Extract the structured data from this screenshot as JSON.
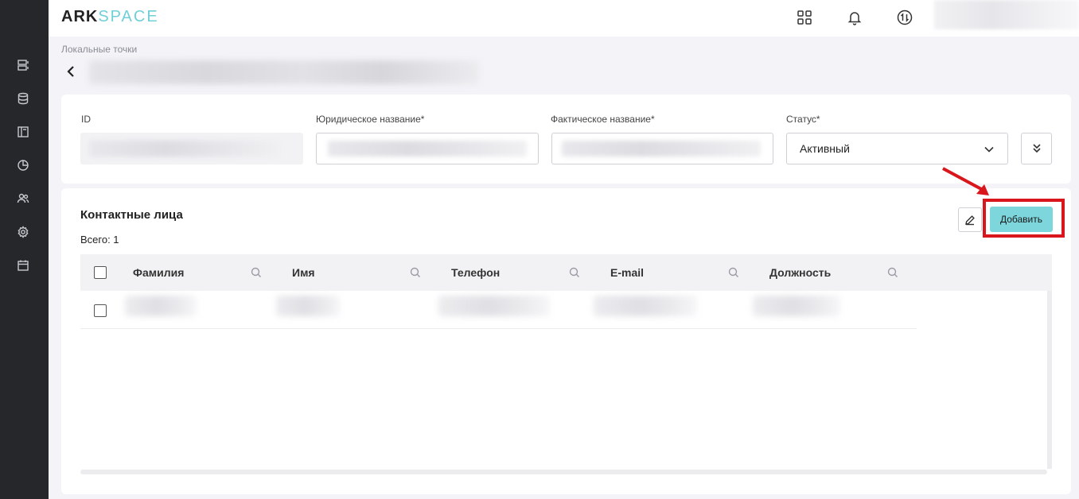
{
  "app": {
    "logo_part1": "ARK",
    "logo_part2": "SPACE"
  },
  "sidebar": {
    "items": [
      {
        "icon": "server-icon"
      },
      {
        "icon": "database-icon"
      },
      {
        "icon": "layout-icon"
      },
      {
        "icon": "pie-chart-icon"
      },
      {
        "icon": "users-icon"
      },
      {
        "icon": "gear-icon"
      },
      {
        "icon": "calendar-icon"
      }
    ]
  },
  "header": {
    "icons": [
      "apps-grid-icon",
      "bell-icon",
      "swap-icon"
    ]
  },
  "breadcrumb": {
    "label": "Локальные точки"
  },
  "form": {
    "id_label": "ID",
    "legal_name_label": "Юридическое название*",
    "actual_name_label": "Фактическое название*",
    "status_label": "Статус*",
    "status_value": "Активный"
  },
  "contacts": {
    "title": "Контактные лица",
    "total": "Всего: 1",
    "add_button": "Добавить",
    "columns": [
      "Фамилия",
      "Имя",
      "Телефон",
      "E-mail",
      "Должность"
    ]
  },
  "colors": {
    "sidebar_bg": "#26272b",
    "accent": "#7dd6dc",
    "highlight": "#d8161b"
  }
}
